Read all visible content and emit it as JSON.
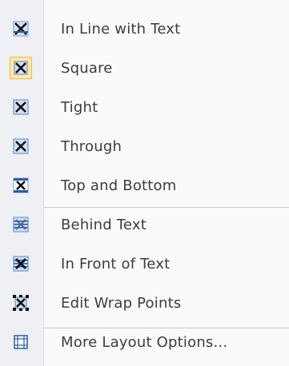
{
  "menu": {
    "items": [
      {
        "label": "In Line with Text",
        "icon": "inline-with-text-icon",
        "selected": false
      },
      {
        "label": "Square",
        "icon": "square-wrap-icon",
        "selected": true
      },
      {
        "label": "Tight",
        "icon": "tight-wrap-icon",
        "selected": false
      },
      {
        "label": "Through",
        "icon": "through-wrap-icon",
        "selected": false
      },
      {
        "label": "Top and Bottom",
        "icon": "top-bottom-wrap-icon",
        "selected": false
      },
      {
        "label": "Behind Text",
        "icon": "behind-text-icon",
        "selected": false
      },
      {
        "label": "In Front of Text",
        "icon": "in-front-of-text-icon",
        "selected": false
      },
      {
        "label": "Edit Wrap Points",
        "icon": "edit-wrap-points-icon",
        "selected": false
      },
      {
        "label": "More Layout Options...",
        "icon": "more-layout-options-icon",
        "selected": false
      }
    ],
    "colors": {
      "gutter": "#eef0f3",
      "selected_fill": "#ffe9a3",
      "selected_border": "#f1b84f",
      "icon_blue": "#2a5ea8",
      "icon_dark": "#1a1a1a"
    }
  }
}
